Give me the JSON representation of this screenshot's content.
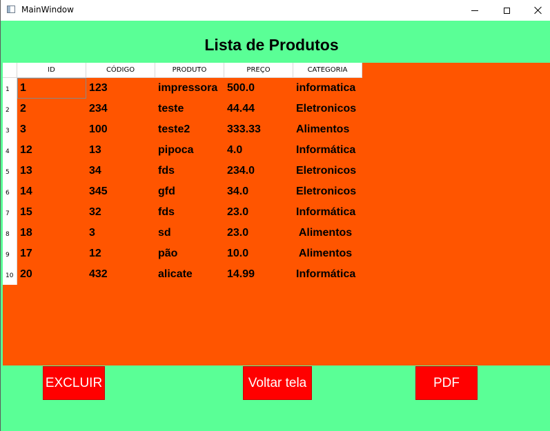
{
  "window": {
    "title": "MainWindow"
  },
  "header": {
    "title": "Lista de Produtos"
  },
  "table": {
    "columns": [
      "ID",
      "CÓDIGO",
      "PRODUTO",
      "PREÇO",
      "CATEGORIA"
    ],
    "row_numbers": [
      "1",
      "2",
      "3",
      "4",
      "5",
      "6",
      "7",
      "8",
      "9",
      "10"
    ],
    "rows": [
      [
        "1",
        "123",
        "impressora",
        "500.0",
        "informatica"
      ],
      [
        "2",
        "234",
        "teste",
        "44.44",
        "Eletronicos"
      ],
      [
        "3",
        "100",
        "teste2",
        "333.33",
        "Alimentos"
      ],
      [
        "12",
        "13",
        "pipoca",
        "4.0",
        "Informática"
      ],
      [
        "13",
        "34",
        "fds",
        "234.0",
        "Eletronicos"
      ],
      [
        "14",
        "345",
        "gfd",
        "34.0",
        "Eletronicos"
      ],
      [
        "15",
        "32",
        "fds",
        "23.0",
        "Informática"
      ],
      [
        "18",
        "3",
        "sd",
        "23.0",
        " Alimentos"
      ],
      [
        "17",
        "12",
        "pão",
        "10.0",
        " Alimentos"
      ],
      [
        "20",
        "432",
        "alicate",
        "14.99",
        "Informática"
      ]
    ]
  },
  "actions": {
    "delete_label": "EXCLUIR",
    "back_label": "Voltar tela",
    "pdf_label": "PDF"
  },
  "colors": {
    "background": "#5aff96",
    "table_background": "#ff5500",
    "button": "#ff0000"
  }
}
